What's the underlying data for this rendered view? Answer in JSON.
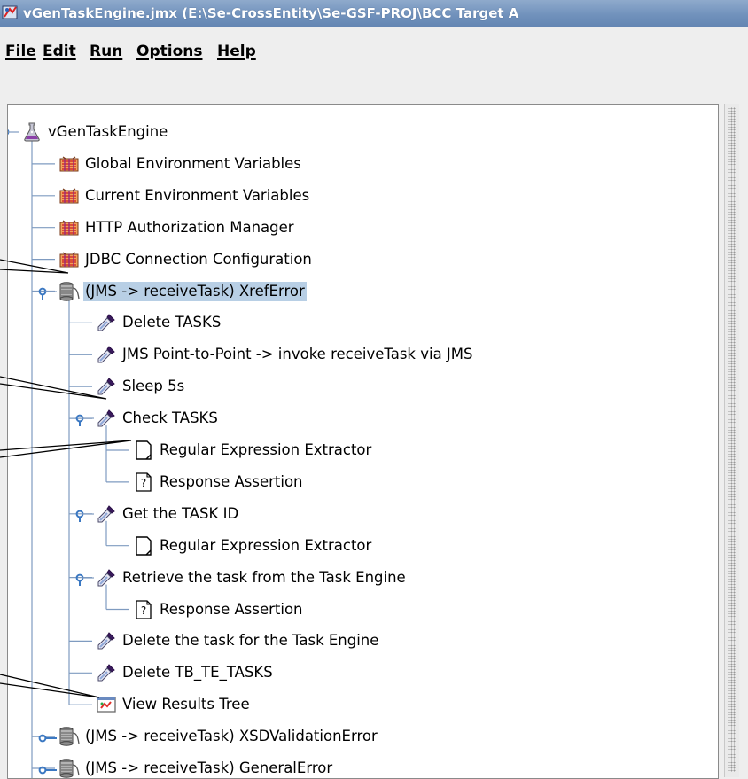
{
  "window": {
    "title": "vGenTaskEngine.jmx (E:\\Se-CrossEntity\\Se-GSF-PROJ\\BCC Target A"
  },
  "menu": {
    "file": "File",
    "edit": "Edit",
    "run": "Run",
    "options": "Options",
    "help": "Help"
  },
  "tree": {
    "nodes": [
      {
        "label": "vGenTaskEngine",
        "icon": "flask-icon",
        "expanded": true
      },
      {
        "label": "Global Environment Variables",
        "icon": "config-element-icon"
      },
      {
        "label": "Current Environment Variables",
        "icon": "config-element-icon"
      },
      {
        "label": "HTTP Authorization Manager",
        "icon": "config-element-icon"
      },
      {
        "label": "JDBC Connection Configuration",
        "icon": "config-element-icon"
      },
      {
        "label": "(JMS -> receiveTask) XrefError",
        "icon": "thread-group-spool-icon",
        "expanded": true,
        "selected": true
      },
      {
        "label": "Delete TASKS",
        "icon": "pipette-sampler-icon"
      },
      {
        "label": "JMS Point-to-Point -> invoke receiveTask via JMS",
        "icon": "pipette-sampler-icon"
      },
      {
        "label": "Sleep 5s",
        "icon": "pipette-sampler-icon"
      },
      {
        "label": "Check TASKS",
        "icon": "pipette-sampler-icon",
        "expanded": true
      },
      {
        "label": "Regular Expression Extractor",
        "icon": "extractor-page-icon"
      },
      {
        "label": "Response Assertion",
        "icon": "assertion-question-icon"
      },
      {
        "label": "Get the TASK ID",
        "icon": "pipette-sampler-icon",
        "expanded": true
      },
      {
        "label": "Regular Expression Extractor",
        "icon": "extractor-page-icon"
      },
      {
        "label": "Retrieve the task from the Task Engine",
        "icon": "pipette-sampler-icon",
        "expanded": true
      },
      {
        "label": "Response Assertion",
        "icon": "assertion-question-icon"
      },
      {
        "label": "Delete the task for the Task Engine",
        "icon": "pipette-sampler-icon"
      },
      {
        "label": "Delete TB_TE_TASKS",
        "icon": "pipette-sampler-icon"
      },
      {
        "label": "View Results Tree",
        "icon": "results-tree-icon"
      },
      {
        "label": "(JMS -> receiveTask) XSDValidationError",
        "icon": "thread-group-spool-icon",
        "expanded": false
      },
      {
        "label": "(JMS -> receiveTask) GeneralError",
        "icon": "thread-group-spool-icon",
        "expanded": false
      }
    ]
  },
  "colors": {
    "selection": "#b8cfe5",
    "tree_line": "#7f9bc0",
    "titlebar": "#7192bc"
  }
}
